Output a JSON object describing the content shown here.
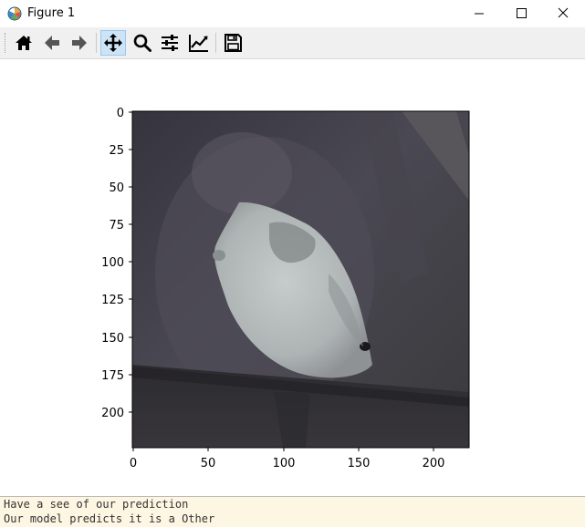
{
  "window": {
    "title": "Figure 1",
    "app_icon": "matplotlib-icon",
    "controls": [
      "minimize-icon",
      "maximize-icon",
      "close-icon"
    ]
  },
  "toolbar": {
    "items": [
      {
        "name": "home-button",
        "icon": "home-icon",
        "active": false
      },
      {
        "name": "back-button",
        "icon": "arrow-left-icon",
        "active": false
      },
      {
        "name": "forward-button",
        "icon": "arrow-right-icon",
        "active": false
      },
      {
        "name": "pan-button",
        "icon": "move-arrows-icon",
        "active": true
      },
      {
        "name": "zoom-button",
        "icon": "magnifier-icon",
        "active": false
      },
      {
        "name": "subplots-button",
        "icon": "sliders-icon",
        "active": false
      },
      {
        "name": "edit-axes-button",
        "icon": "line-chart-icon",
        "active": false
      },
      {
        "name": "save-button",
        "icon": "floppy-disk-icon",
        "active": false
      }
    ]
  },
  "figure": {
    "xticks": [
      "0",
      "50",
      "100",
      "150",
      "200"
    ],
    "yticks": [
      "0",
      "25",
      "50",
      "75",
      "100",
      "125",
      "150",
      "175",
      "200"
    ],
    "image_content": "photo of a white bird on a dark branch",
    "colors": {
      "background": "#3f3c44",
      "bird": "#b8bcbc"
    }
  },
  "status": {
    "line1": "Have a see of our prediction",
    "line2": "Our model predicts it is a Other"
  }
}
